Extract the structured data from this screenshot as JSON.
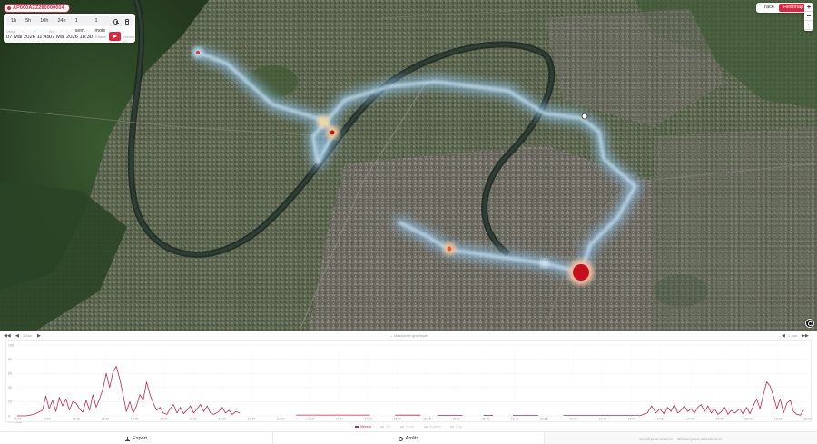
{
  "device": {
    "id": "AP000AZZ280000004",
    "status_color": "#d9283f"
  },
  "time_range": {
    "options": [
      "1h",
      "5h",
      "10h",
      "24h",
      "1 sem.",
      "1 mois"
    ],
    "icons": [
      "clock-icon",
      "calendar-icon"
    ],
    "start_label": "Début",
    "start_value": "07 Mai 2026 11:45",
    "end_label": "Fin",
    "end_value": "07 Mai 2026 18:30",
    "clear_label": "Effacer",
    "play_icon": "play-icon",
    "speed_label": "Vitesse ×5"
  },
  "view_toggle": {
    "trace_label": "Tracé",
    "heatmap_label": "Heatmap",
    "active": "heatmap"
  },
  "zoom": {
    "in_label": "+",
    "out_label": "−",
    "reset_label": "·"
  },
  "accent_color": "#d9283f",
  "timeline": {
    "prev_label": "1 Jour",
    "toggle_label": "Masquer le graphique",
    "next_label": "1 Jour"
  },
  "chart_data": {
    "type": "line",
    "ylim": [
      0,
      100
    ],
    "y_ticks": [
      "100",
      "80",
      "60",
      "40",
      "20",
      "0"
    ],
    "x_ticks": [
      "11:45",
      "12:00",
      "12:15",
      "12:30",
      "12:45",
      "13:00",
      "13:15",
      "13:30",
      "13:45",
      "14:00",
      "14:15",
      "14:30",
      "14:45",
      "15:00",
      "15:15",
      "15:30",
      "15:45",
      "16:00",
      "16:15",
      "16:30",
      "16:45",
      "17:00",
      "17:15",
      "17:30",
      "17:45",
      "18:00",
      "18:15",
      "18:30"
    ],
    "x_sublabel": "jeu. 07/05",
    "series": [
      {
        "name": "Vitesse",
        "color": "#c2284a",
        "segments": [
          [
            [
              0,
              0
            ],
            [
              1,
              0
            ],
            [
              2,
              2
            ],
            [
              3,
              8
            ],
            [
              3.4,
              28
            ],
            [
              3.8,
              10
            ],
            [
              4.2,
              22
            ],
            [
              4.6,
              6
            ],
            [
              5.0,
              26
            ],
            [
              5.4,
              14
            ],
            [
              5.8,
              24
            ],
            [
              6.2,
              8
            ],
            [
              6.6,
              20
            ],
            [
              7.0,
              18
            ],
            [
              7.4,
              10
            ],
            [
              7.8,
              5
            ],
            [
              8.2,
              22
            ],
            [
              8.6,
              8
            ],
            [
              9.0,
              30
            ],
            [
              9.4,
              12
            ],
            [
              9.8,
              24
            ],
            [
              10.2,
              38
            ],
            [
              10.6,
              60
            ],
            [
              11.0,
              40
            ],
            [
              11.4,
              62
            ],
            [
              11.8,
              70
            ],
            [
              12.2,
              52
            ],
            [
              12.6,
              30
            ],
            [
              13.0,
              6
            ],
            [
              13.4,
              20
            ],
            [
              13.8,
              4
            ],
            [
              14.2,
              14
            ],
            [
              14.6,
              30
            ],
            [
              15.0,
              22
            ],
            [
              15.4,
              48
            ],
            [
              15.8,
              30
            ],
            [
              16.2,
              18
            ],
            [
              16.6,
              8
            ],
            [
              17.0,
              12
            ],
            [
              17.4,
              4
            ],
            [
              17.8,
              2
            ],
            [
              18.2,
              10
            ],
            [
              18.6,
              16
            ],
            [
              19.0,
              4
            ],
            [
              19.4,
              12
            ],
            [
              19.8,
              3
            ],
            [
              20.2,
              8
            ],
            [
              20.6,
              14
            ],
            [
              21.0,
              4
            ],
            [
              21.4,
              10
            ],
            [
              21.8,
              16
            ],
            [
              22.2,
              6
            ],
            [
              22.6,
              14
            ],
            [
              23.0,
              4
            ],
            [
              23.4,
              2
            ],
            [
              24.0,
              6
            ],
            [
              24.4,
              12
            ],
            [
              24.8,
              4
            ],
            [
              25.2,
              8
            ],
            [
              25.6,
              2
            ],
            [
              26,
              6
            ],
            [
              26.5,
              4
            ]
          ]
        ]
      }
    ],
    "gap_segments": [
      [
        [
          33.2,
          1.2
        ],
        [
          42,
          1.2
        ]
      ],
      [
        [
          45,
          1
        ],
        [
          48,
          1
        ]
      ],
      [
        [
          50,
          0.8
        ],
        [
          53,
          0.8
        ]
      ],
      [
        [
          55.5,
          0.8
        ],
        [
          56.6,
          0.8
        ]
      ],
      [
        [
          59,
          0.8
        ],
        [
          62,
          0.8
        ]
      ],
      [
        [
          65,
          0.8
        ],
        [
          74,
          0.8
        ]
      ]
    ],
    "tail_segment": [
      [
        74,
        0
      ],
      [
        75,
        4
      ],
      [
        75.5,
        14
      ],
      [
        76,
        4
      ],
      [
        76.5,
        10
      ],
      [
        77,
        2
      ],
      [
        77.4,
        12
      ],
      [
        77.8,
        6
      ],
      [
        78.2,
        16
      ],
      [
        78.6,
        4
      ],
      [
        79,
        8
      ],
      [
        79.4,
        14
      ],
      [
        79.8,
        6
      ],
      [
        80.2,
        10
      ],
      [
        80.6,
        4
      ],
      [
        81,
        12
      ],
      [
        81.4,
        16
      ],
      [
        81.8,
        6
      ],
      [
        82.2,
        14
      ],
      [
        82.6,
        4
      ],
      [
        83,
        10
      ],
      [
        83.4,
        2
      ],
      [
        83.8,
        6
      ],
      [
        84.2,
        12
      ],
      [
        84.6,
        2
      ],
      [
        85,
        8
      ],
      [
        85.4,
        4
      ],
      [
        86,
        10
      ],
      [
        86.4,
        2
      ],
      [
        86.8,
        12
      ],
      [
        87.2,
        3
      ],
      [
        87.6,
        14
      ],
      [
        88,
        24
      ],
      [
        88.4,
        10
      ],
      [
        88.8,
        30
      ],
      [
        89.2,
        48
      ],
      [
        89.6,
        42
      ],
      [
        90,
        28
      ],
      [
        90.4,
        10
      ],
      [
        90.8,
        24
      ],
      [
        91.2,
        4
      ],
      [
        91.6,
        18
      ],
      [
        92,
        22
      ],
      [
        92.4,
        6
      ],
      [
        92.8,
        2
      ],
      [
        93.2,
        1
      ],
      [
        93.6,
        8
      ]
    ],
    "legend": [
      {
        "label": "Vitesse",
        "active": true
      },
      {
        "label": "Alt.",
        "active": false
      },
      {
        "label": "Temp.",
        "active": false
      },
      {
        "label": "Batterie",
        "active": false
      },
      {
        "label": "Cap",
        "active": false
      }
    ]
  },
  "bottom_bar": {
    "export_label": "Export",
    "export_icon": "download-icon",
    "stops_label": "Arrêts",
    "stops_icon": "stop-icon",
    "hint_text": "Scroll pour zoomer · Glisser pour sélectionner"
  },
  "map": {
    "heat_points": [
      {
        "label": "start",
        "color": "#d6e7f5"
      },
      {
        "label": "hotspot",
        "color": "#c40f1f"
      }
    ]
  }
}
